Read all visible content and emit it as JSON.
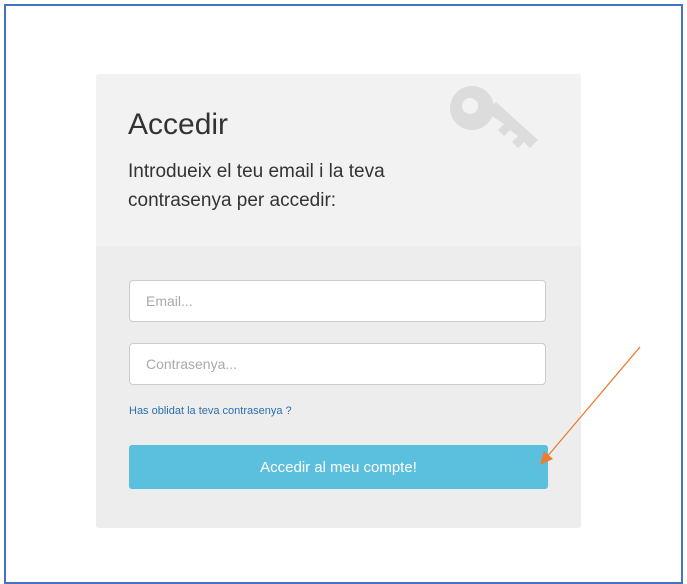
{
  "login": {
    "title": "Accedir",
    "subtitle": "Introdueix el teu email i la teva contrasenya per accedir:",
    "email_placeholder": "Email...",
    "password_placeholder": "Contrasenya...",
    "forgot_link": "Has oblidat la teva contrasenya ?",
    "submit_label": "Accedir al meu compte!"
  },
  "icons": {
    "header": "key-icon",
    "annotation": "arrow-annotation"
  },
  "colors": {
    "frame_border": "#4472c4",
    "card_background": "#ededed",
    "button_background": "#5bc0de",
    "link": "#2a6fb0",
    "annotation_arrow": "#ed7d31"
  }
}
